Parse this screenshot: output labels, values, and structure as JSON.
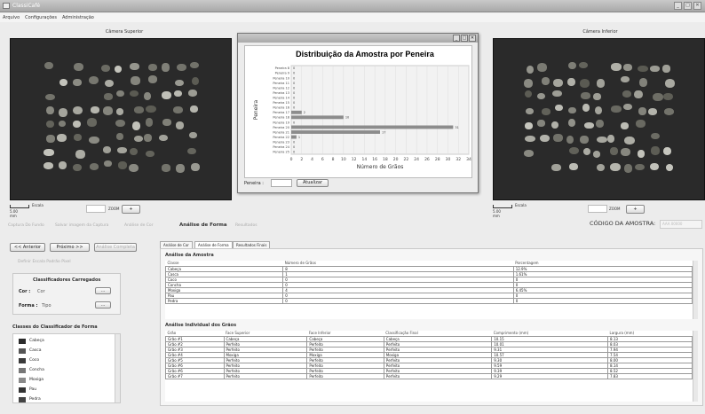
{
  "window": {
    "title": "ClassiCafé",
    "min": "_",
    "max": "□"
  },
  "menu": [
    "Arquivo",
    "Configurações",
    "Administração"
  ],
  "cams": {
    "top_label": "Câmera Superior",
    "bottom_label": "Câmera Inferior",
    "scale_label": "Escala",
    "scale_value": "5.00 mm",
    "zoom_label": "ZOOM",
    "zoom_btn": "+"
  },
  "midbar": {
    "t1": "Captura Do Fundo",
    "t2": "Salvar imagem da Captura",
    "t3": "Análise de Cor",
    "t4": "Análise de Forma",
    "t5": "Resultados"
  },
  "codigo": {
    "label": "CÓDIGO DA AMOSTRA:",
    "value": "AAA 00000"
  },
  "nav": {
    "prev": "<< Anterior",
    "next": "Próximo >>",
    "complete": "Análise Completa",
    "def_mask": "Definir Escala Padrão Pixel"
  },
  "loaded": {
    "title": "Classificadores Carregados",
    "cor_label": "Cor :",
    "cor_value": "Cor",
    "forma_label": "Forma :",
    "forma_value": "Tipo",
    "btn": "..."
  },
  "classes": {
    "title": "Classes do Classificador de Forma",
    "items": [
      {
        "label": "Cabeça",
        "color": "#2b2b2b"
      },
      {
        "label": "Casca",
        "color": "#555555"
      },
      {
        "label": "Coco",
        "color": "#3a3a3a"
      },
      {
        "label": "Concha",
        "color": "#777777"
      },
      {
        "label": "Moxiga",
        "color": "#8a8a8a"
      },
      {
        "label": "Pau",
        "color": "#333333"
      },
      {
        "label": "Pedra",
        "color": "#444444"
      }
    ]
  },
  "tabs": [
    "Análise de Cor",
    "Análise de Forma",
    "Resultados Finais"
  ],
  "amostra": {
    "title": "Análise da Amostra",
    "headers": [
      "Classe",
      "Número de Grãos",
      "Porcentagem"
    ],
    "rows": [
      [
        "Cabeça",
        "8",
        "12.9%"
      ],
      [
        "Casca",
        "1",
        "1.61%"
      ],
      [
        "Coco",
        "0",
        "0"
      ],
      [
        "Concha",
        "0",
        "0"
      ],
      [
        "Moxiga",
        "4",
        "6.45%"
      ],
      [
        "Pau",
        "0",
        "0"
      ],
      [
        "Pedra",
        "0",
        "0"
      ]
    ]
  },
  "individual": {
    "title": "Análise Individual dos Grãos",
    "headers": [
      "Grão",
      "Face Superior",
      "Face Inferior",
      "Classificação Final",
      "Comprimento (mm)",
      "Largura (mm)"
    ],
    "rows": [
      [
        "Grão #1",
        "Cabeça",
        "Cabeça",
        "Cabeça",
        "10.15",
        "8.13"
      ],
      [
        "Grão #2",
        "Perfeito",
        "Perfeito",
        "Perfeito",
        "10.01",
        "8.03"
      ],
      [
        "Grão #3",
        "Perfeito",
        "Perfeito",
        "Perfeito",
        "9.31",
        "7.94"
      ],
      [
        "Grão #4",
        "Moxiga",
        "Moxiga",
        "Moxiga",
        "10.57",
        "7.54"
      ],
      [
        "Grão #5",
        "Perfeito",
        "Perfeito",
        "Perfeito",
        "9.30",
        "8.00"
      ],
      [
        "Grão #6",
        "Perfeito",
        "Perfeito",
        "Perfeito",
        "9.59",
        "8.14"
      ],
      [
        "Grão #6",
        "Perfeito",
        "Perfeito",
        "Perfeito",
        "9.39",
        "8.52"
      ],
      [
        "Grão #7",
        "Perfeito",
        "Perfeito",
        "Perfeito",
        "9.29",
        "7.83"
      ]
    ]
  },
  "popup": {
    "peneira_label": "Peneira :",
    "ok_btn": "Atualizar"
  },
  "chart_data": {
    "type": "bar",
    "title": "Distribuição da Amostra por Peneira",
    "xlabel": "Número de Grãos",
    "ylabel": "Peneira",
    "xlim": [
      0,
      34
    ],
    "xticks": [
      0,
      2,
      4,
      6,
      8,
      10,
      12,
      14,
      16,
      18,
      20,
      22,
      24,
      26,
      28,
      30,
      32,
      34
    ],
    "categories": [
      "Peneira 8",
      "Peneira 9",
      "Peneira 10",
      "Peneira 11",
      "Peneira 12",
      "Peneira 13",
      "Peneira 14",
      "Peneira 15",
      "Peneira 16",
      "Peneira 17",
      "Peneira 18",
      "Peneira 19",
      "Peneira 20",
      "Peneira 21",
      "Peneira 22",
      "Peneira 23",
      "Peneira 24",
      "Peneira 25"
    ],
    "values": [
      0,
      0,
      0,
      0,
      0,
      0,
      0,
      0,
      0,
      2,
      10,
      0,
      31,
      17,
      1,
      0,
      0,
      0
    ]
  }
}
